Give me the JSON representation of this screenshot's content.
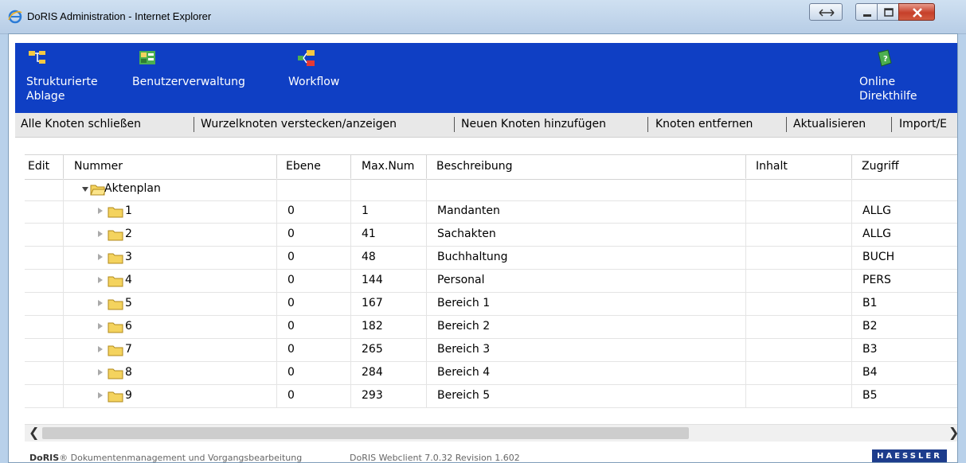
{
  "window": {
    "title": "DoRIS Administration - Internet Explorer"
  },
  "nav": {
    "items": [
      {
        "label_line1": "Strukturierte",
        "label_line2": "Ablage",
        "icon": "tree-structure-icon"
      },
      {
        "label_line1": "Benutzerverwaltung",
        "label_line2": "",
        "icon": "users-icon"
      },
      {
        "label_line1": "Workflow",
        "label_line2": "",
        "icon": "workflow-icon"
      },
      {
        "label_line1": "Online",
        "label_line2": "Direkthilfe",
        "icon": "help-book-icon"
      }
    ]
  },
  "actions": [
    "Alle Knoten schließen",
    "Wurzelknoten verstecken/anzeigen",
    "Neuen Knoten hinzufügen",
    "Knoten entfernen",
    "Aktualisieren",
    "Import/E"
  ],
  "table": {
    "columns": [
      "Edit",
      "Nummer",
      "Ebene",
      "Max.Num",
      "Beschreibung",
      "Inhalt",
      "Zugriff"
    ],
    "root": {
      "nummer": "Aktenplan"
    },
    "rows": [
      {
        "nummer": "1",
        "ebene": "0",
        "maxnum": "1",
        "beschreibung": "Mandanten",
        "inhalt": "",
        "zugriff": "ALLG"
      },
      {
        "nummer": "2",
        "ebene": "0",
        "maxnum": "41",
        "beschreibung": "Sachakten",
        "inhalt": "",
        "zugriff": "ALLG"
      },
      {
        "nummer": "3",
        "ebene": "0",
        "maxnum": "48",
        "beschreibung": "Buchhaltung",
        "inhalt": "",
        "zugriff": "BUCH"
      },
      {
        "nummer": "4",
        "ebene": "0",
        "maxnum": "144",
        "beschreibung": "Personal",
        "inhalt": "",
        "zugriff": "PERS"
      },
      {
        "nummer": "5",
        "ebene": "0",
        "maxnum": "167",
        "beschreibung": "Bereich 1",
        "inhalt": "",
        "zugriff": "B1"
      },
      {
        "nummer": "6",
        "ebene": "0",
        "maxnum": "182",
        "beschreibung": "Bereich 2",
        "inhalt": "",
        "zugriff": "B2"
      },
      {
        "nummer": "7",
        "ebene": "0",
        "maxnum": "265",
        "beschreibung": "Bereich 3",
        "inhalt": "",
        "zugriff": "B3"
      },
      {
        "nummer": "8",
        "ebene": "0",
        "maxnum": "284",
        "beschreibung": "Bereich 4",
        "inhalt": "",
        "zugriff": "B4"
      },
      {
        "nummer": "9",
        "ebene": "0",
        "maxnum": "293",
        "beschreibung": "Bereich 5",
        "inhalt": "",
        "zugriff": "B5"
      }
    ]
  },
  "footer": {
    "brand": "DoRIS",
    "brand_suffix": "® Dokumentenmanagement und Vorgangsbearbeitung",
    "version": "DoRIS Webclient 7.0.32 Revision 1.602",
    "logo": "HAESSLER"
  },
  "colors": {
    "nav_bg": "#0f3fc4",
    "folder": "#f4d35e"
  }
}
